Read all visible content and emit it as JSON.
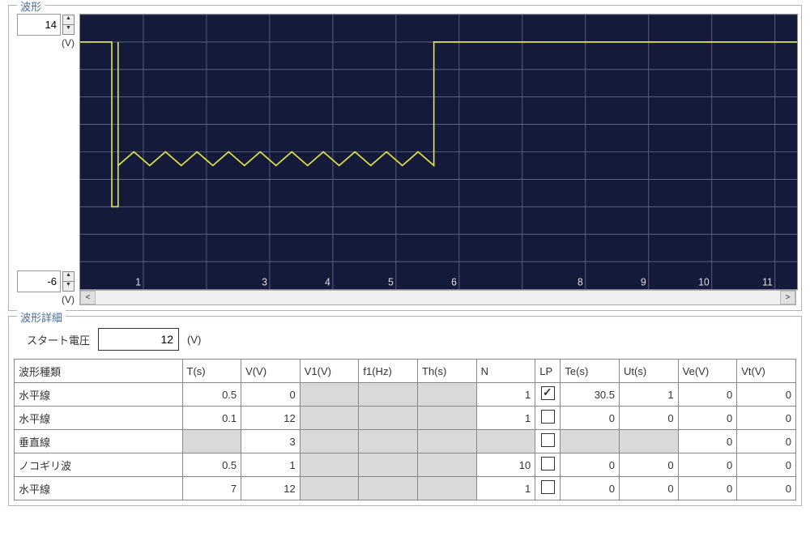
{
  "wave_panel": {
    "title": "波形",
    "y_max": 14,
    "y_min": -6,
    "y_unit_top": "(V)",
    "y_unit_bottom": "(V)"
  },
  "chart_data": {
    "type": "line",
    "xlabel": "",
    "ylabel": "",
    "x_ticks": [
      1,
      3,
      4,
      5,
      6,
      8,
      9,
      10,
      11
    ],
    "ylim": [
      -6,
      14
    ],
    "xlim": [
      0,
      11.35
    ],
    "series": [
      {
        "name": "waveform",
        "color": "#e7e73a",
        "points": [
          [
            0.0,
            12
          ],
          [
            0.5,
            12
          ],
          [
            0.5,
            0
          ],
          [
            0.6,
            0
          ],
          [
            0.6,
            12
          ],
          [
            0.6,
            3
          ],
          [
            0.85,
            4
          ],
          [
            1.1,
            3
          ],
          [
            1.35,
            4
          ],
          [
            1.6,
            3
          ],
          [
            1.85,
            4
          ],
          [
            2.1,
            3
          ],
          [
            2.35,
            4
          ],
          [
            2.6,
            3
          ],
          [
            2.85,
            4
          ],
          [
            3.1,
            3
          ],
          [
            3.35,
            4
          ],
          [
            3.6,
            3
          ],
          [
            3.85,
            4
          ],
          [
            4.1,
            3
          ],
          [
            4.35,
            4
          ],
          [
            4.6,
            3
          ],
          [
            4.85,
            4
          ],
          [
            5.1,
            3
          ],
          [
            5.35,
            4
          ],
          [
            5.6,
            3
          ],
          [
            5.6,
            12
          ],
          [
            12.6,
            12
          ]
        ]
      }
    ]
  },
  "detail_panel": {
    "title": "波形詳細",
    "start_voltage_label": "スタート電圧",
    "start_voltage_value": 12,
    "start_voltage_unit": "(V)",
    "columns": [
      "波形種類",
      "T(s)",
      "V(V)",
      "V1(V)",
      "f1(Hz)",
      "Th(s)",
      "N",
      "LP",
      "Te(s)",
      "Ut(s)",
      "Ve(V)",
      "Vt(V)"
    ],
    "rows": [
      {
        "type": "水平線",
        "T": 0.5,
        "V": 0,
        "V1": null,
        "f1": null,
        "Th": null,
        "N": 1,
        "LP": true,
        "Te": 30.5,
        "Ut": 1,
        "Ve": 0,
        "Vt": 0
      },
      {
        "type": "水平線",
        "T": 0.1,
        "V": 12,
        "V1": null,
        "f1": null,
        "Th": null,
        "N": 1,
        "LP": false,
        "Te": 0,
        "Ut": 0,
        "Ve": 0,
        "Vt": 0
      },
      {
        "type": "垂直線",
        "T": null,
        "V": 3,
        "V1": null,
        "f1": null,
        "Th": null,
        "N": null,
        "LP": false,
        "Te": null,
        "Ut": null,
        "Ve": 0,
        "Vt": 0
      },
      {
        "type": "ノコギリ波",
        "T": 0.5,
        "V": 1,
        "V1": null,
        "f1": null,
        "Th": null,
        "N": 10,
        "LP": false,
        "Te": 0,
        "Ut": 0,
        "Ve": 0,
        "Vt": 0
      },
      {
        "type": "水平線",
        "T": 7,
        "V": 12,
        "V1": null,
        "f1": null,
        "Th": null,
        "N": 1,
        "LP": false,
        "Te": 0,
        "Ut": 0,
        "Ve": 0,
        "Vt": 0
      }
    ]
  }
}
